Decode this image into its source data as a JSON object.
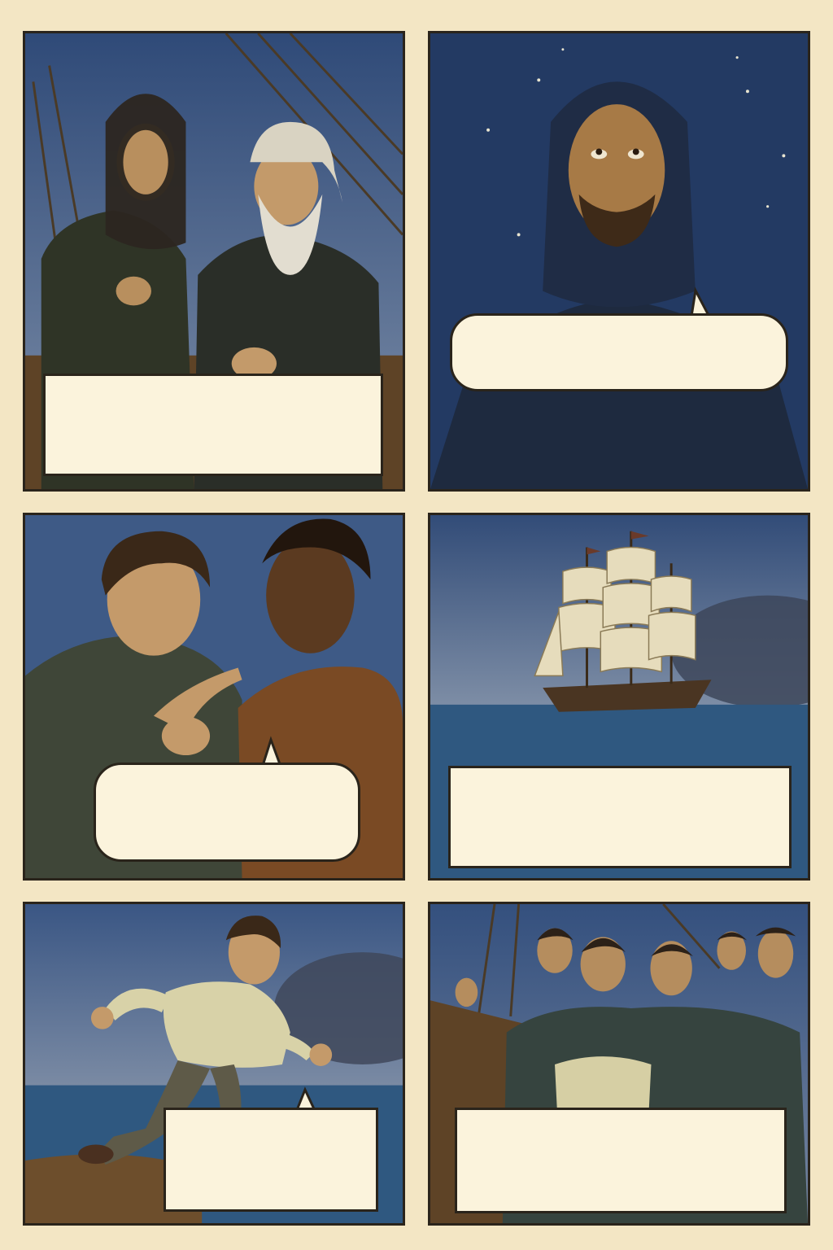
{
  "panels": [
    {
      "id": 1,
      "scene": "two-men-on-deck-at-dusk",
      "text": ""
    },
    {
      "id": 2,
      "scene": "hooded-man-under-night-sky",
      "text": ""
    },
    {
      "id": 3,
      "scene": "young-man-pointing-beside-companion",
      "text": ""
    },
    {
      "id": 4,
      "scene": "sailing-ship-at-sea",
      "text": ""
    },
    {
      "id": 5,
      "scene": "young-man-running-on-deck",
      "text": ""
    },
    {
      "id": 6,
      "scene": "crew-rushing-forward",
      "text": ""
    }
  ],
  "colors": {
    "page": "#f3e6c4",
    "ink": "#2a241b",
    "sky": "#3e5a86",
    "night": "#233a63",
    "sea": "#2f5880",
    "wood": "#5e4326",
    "balloon": "#fbf3dc"
  }
}
